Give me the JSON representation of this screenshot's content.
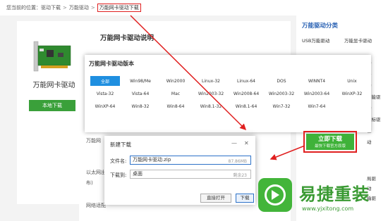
{
  "breadcrumb": {
    "prefix": "您当前的位置：",
    "items": [
      "驱动下载",
      "万能驱动",
      "万能网卡驱动下载"
    ],
    "separator": ">"
  },
  "product": {
    "title": "万能网卡驱动",
    "local_download": "本地下载"
  },
  "main": {
    "title": "万能网卡驱动说明",
    "side_texts": [
      "万能网",
      "以太网出",
      "布)",
      "网络适配"
    ]
  },
  "versions": {
    "title": "万能网卡驱动版本",
    "items": [
      "全部",
      "Win98/Me",
      "Win2000",
      "Linux-32",
      "Linux-64",
      "DOS",
      "WINNT4",
      "Unix",
      "Vista-32",
      "Vista-64",
      "Mac",
      "Win2003-32",
      "Win2008-64",
      "Win2003-32",
      "Win2003-64",
      "WinXP-32",
      "WinXP-64",
      "Win8-32",
      "Win8-64",
      "Win8.1-32",
      "Win8.1-64",
      "Win7-32",
      "Win7-64",
      ""
    ]
  },
  "category": {
    "title": "万能驱动分类",
    "items": [
      "USB万能驱动",
      "万能显卡驱动",
      "动",
      "卡",
      "动",
      "万能驱",
      "动",
      "鼠标驱",
      "驱",
      "动",
      "局驱",
      "动",
      "输驱"
    ]
  },
  "dialog": {
    "title": "新建下载",
    "filename_label": "文件名:",
    "filename_value": "万能网卡驱动.zip",
    "size": "87.86MB",
    "download_to_label": "下载到:",
    "download_to_value": "桌面",
    "free_space": "剩余23",
    "open_direct": "直接打开",
    "download": "下载",
    "minimize": "—",
    "close": "✕"
  },
  "now_download": {
    "label": "立即下载",
    "sub": "最快下载官方原版"
  },
  "logo": {
    "name": "易捷重装",
    "url": "www.yjxitong.com"
  },
  "colors": {
    "accent_green": "#3fb239",
    "highlight_red": "#e02020",
    "link_blue": "#2a62b4"
  }
}
